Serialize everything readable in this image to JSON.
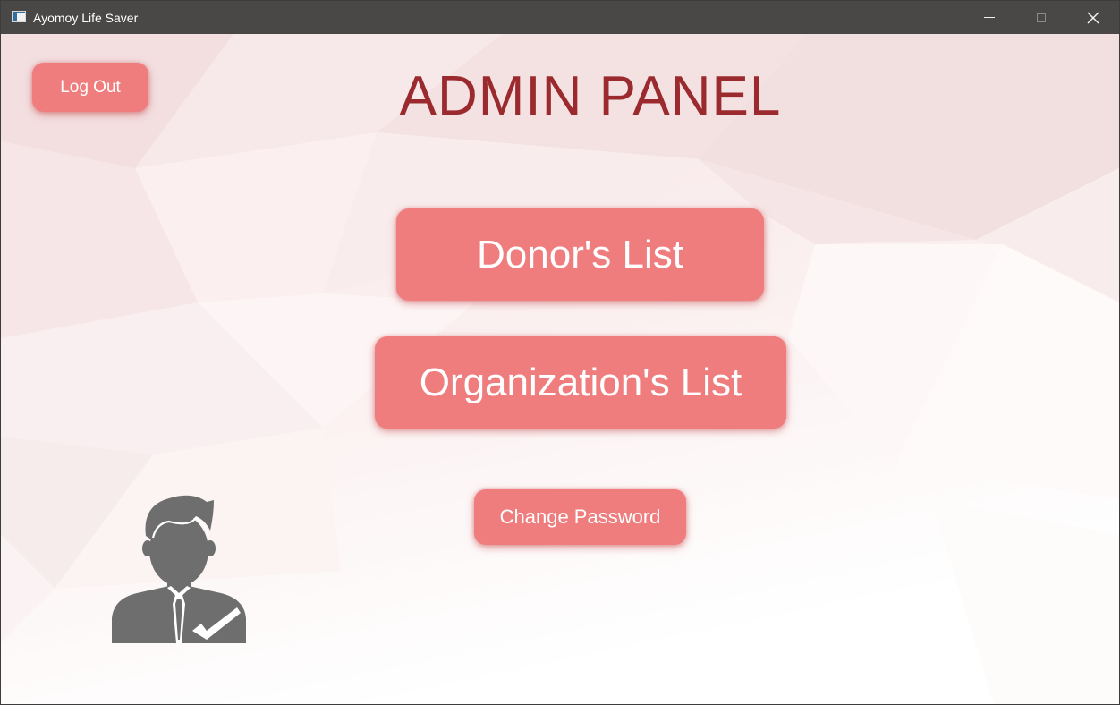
{
  "window": {
    "title": "Ayomoy Life Saver"
  },
  "header": {
    "title": "ADMIN PANEL"
  },
  "actions": {
    "logout_label": "Log Out",
    "donors_label": "Donor's List",
    "organizations_label": "Organization's List",
    "change_password_label": "Change Password"
  },
  "icons": {
    "app": "app-window-icon",
    "minimize": "minimize-icon",
    "maximize": "maximize-icon",
    "close": "close-icon",
    "avatar": "admin-user-icon"
  },
  "colors": {
    "title_bar": "#4a4846",
    "heading": "#9b2a2f",
    "button": "#ef7d7e",
    "button_text": "#ffffff",
    "avatar": "#6e6e6e"
  }
}
